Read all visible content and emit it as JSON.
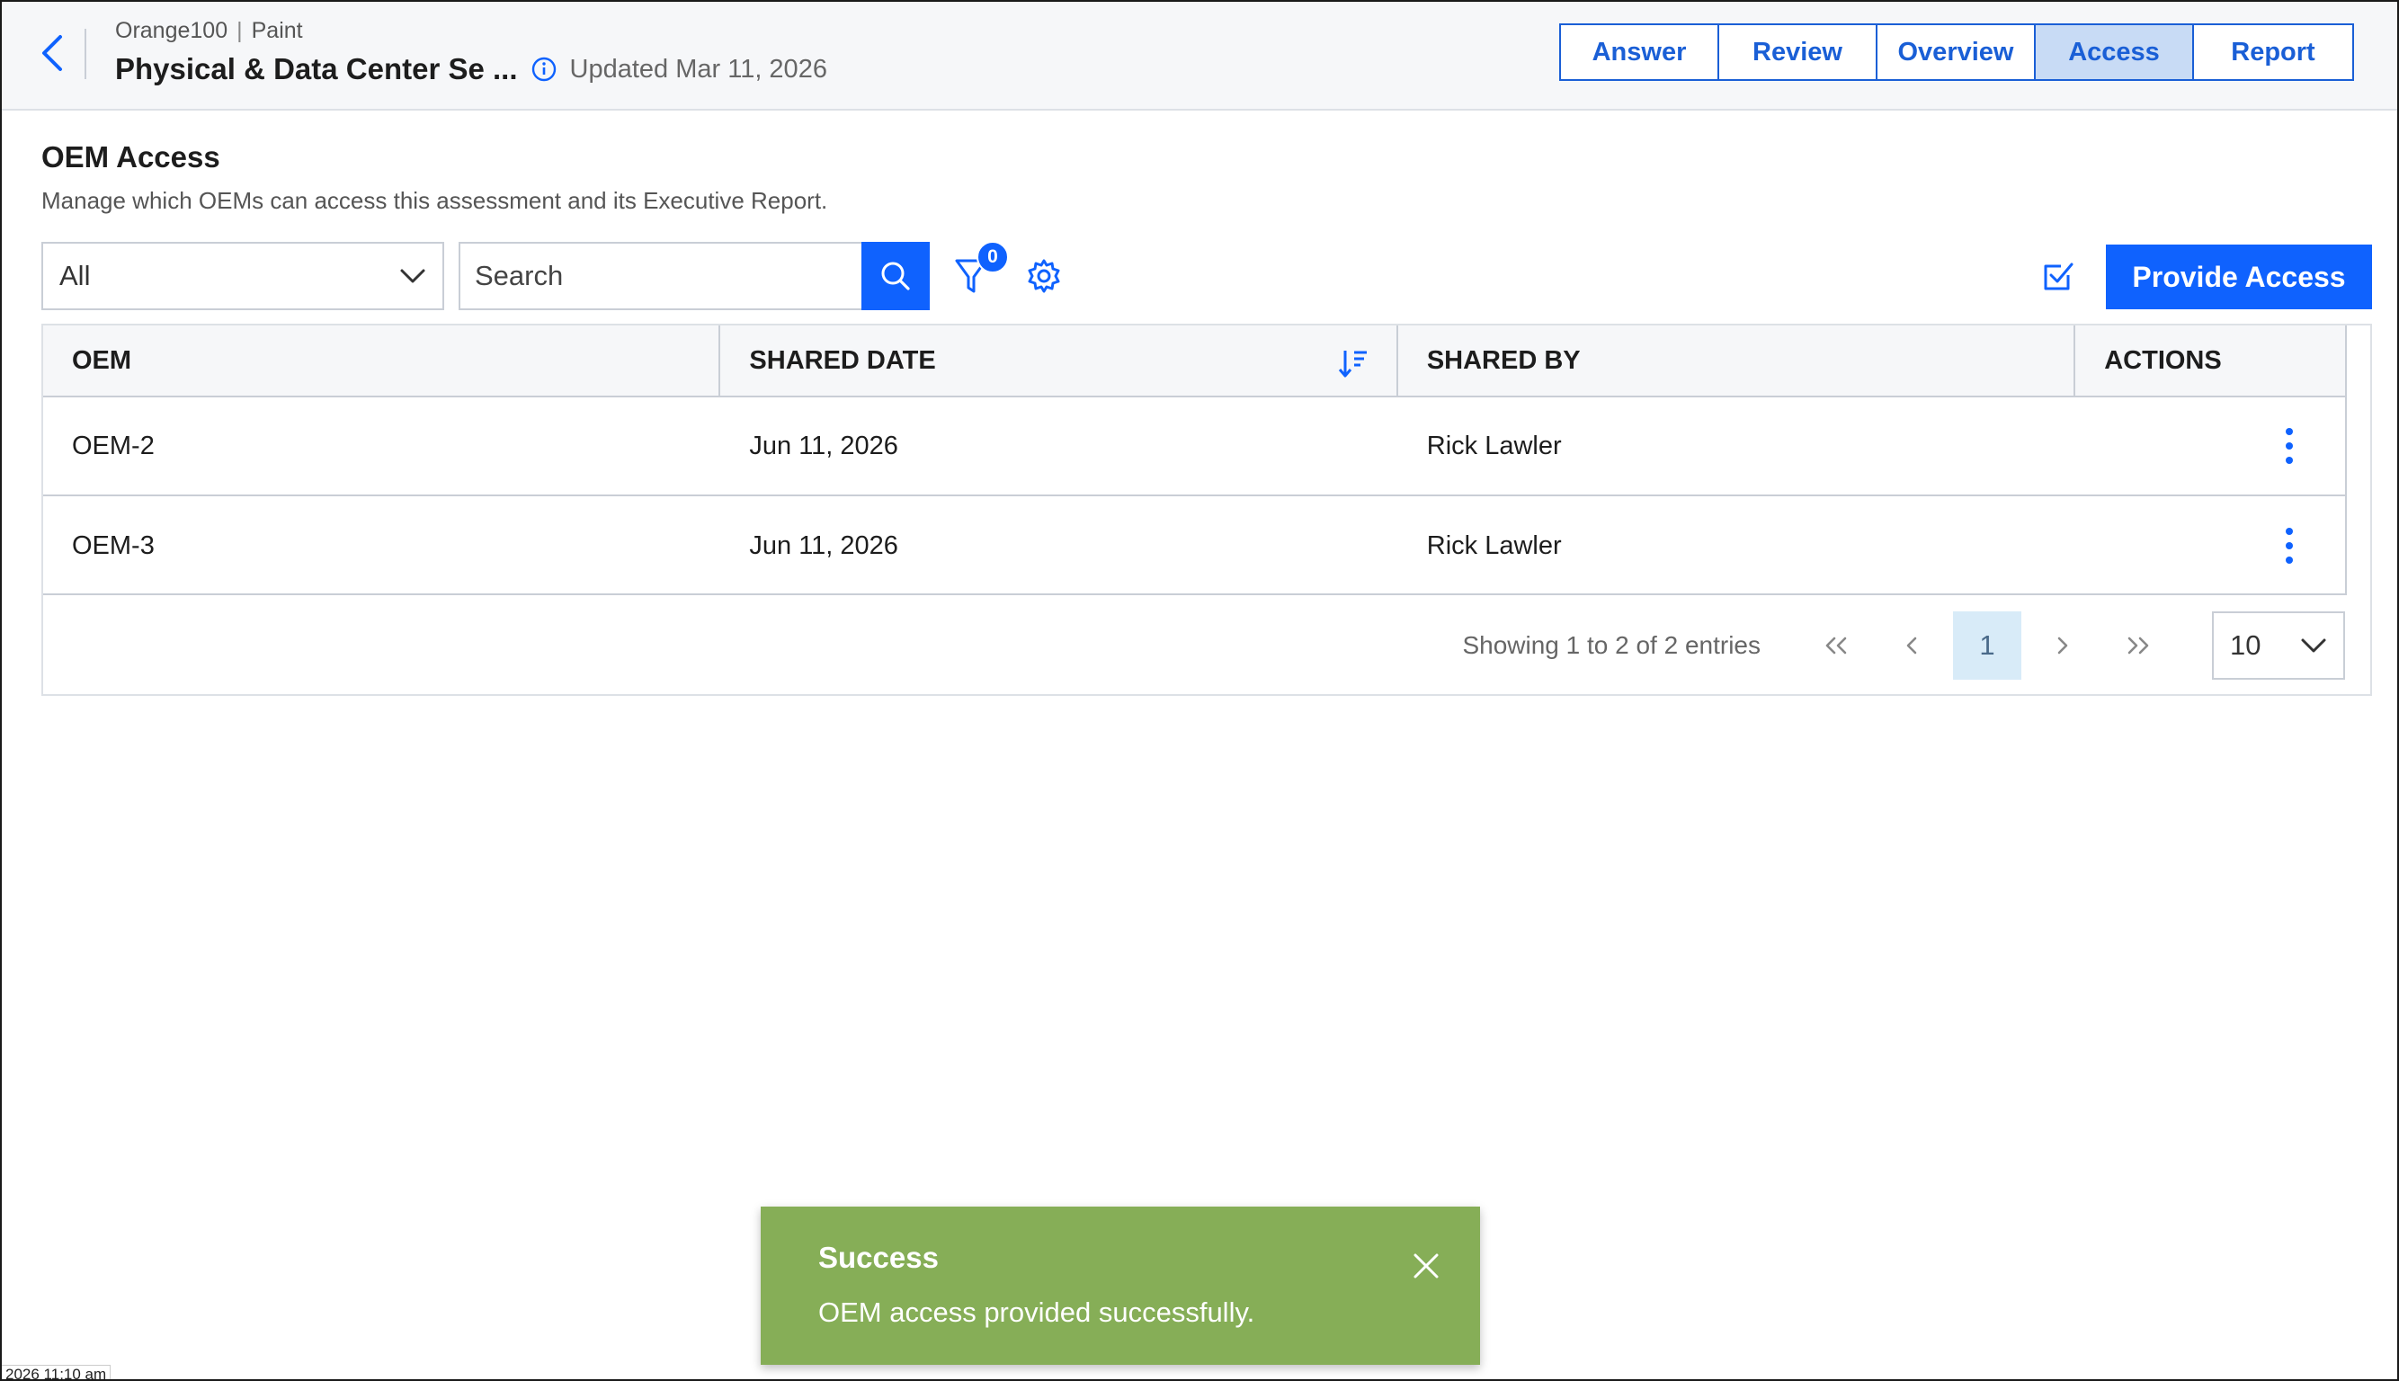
{
  "header": {
    "breadcrumb": [
      "Orange100",
      "Paint"
    ],
    "breadcrumb_sep": "|",
    "title": "Physical & Data Center Se ...",
    "updated": "Updated Mar 11, 2026",
    "tabs": [
      {
        "label": "Answer",
        "active": false
      },
      {
        "label": "Review",
        "active": false
      },
      {
        "label": "Overview",
        "active": false
      },
      {
        "label": "Access",
        "active": true
      },
      {
        "label": "Report",
        "active": false
      }
    ]
  },
  "section": {
    "title": "OEM Access",
    "description": "Manage which OEMs can access this assessment and its Executive Report."
  },
  "toolbar": {
    "filter_select_value": "All",
    "search_placeholder": "Search",
    "filter_count": "0",
    "provide_access_label": "Provide Access"
  },
  "table": {
    "columns": [
      "OEM",
      "SHARED DATE",
      "SHARED BY",
      "ACTIONS"
    ],
    "rows": [
      {
        "oem": "OEM-2",
        "shared_date": "Jun 11, 2026",
        "shared_by": "Rick Lawler"
      },
      {
        "oem": "OEM-3",
        "shared_date": "Jun 11, 2026",
        "shared_by": "Rick Lawler"
      }
    ]
  },
  "pagination": {
    "info": "Showing 1 to 2 of 2 entries",
    "current_page": "1",
    "page_size": "10"
  },
  "toast": {
    "title": "Success",
    "message": "OEM access provided successfully.",
    "color": "#86ae57"
  },
  "footer": {
    "timestamp": "2026 11:10 am"
  },
  "colors": {
    "primary": "#0f62fe",
    "tab_active_bg": "#c8dbf5",
    "page_current_bg": "#d8ebf8"
  }
}
